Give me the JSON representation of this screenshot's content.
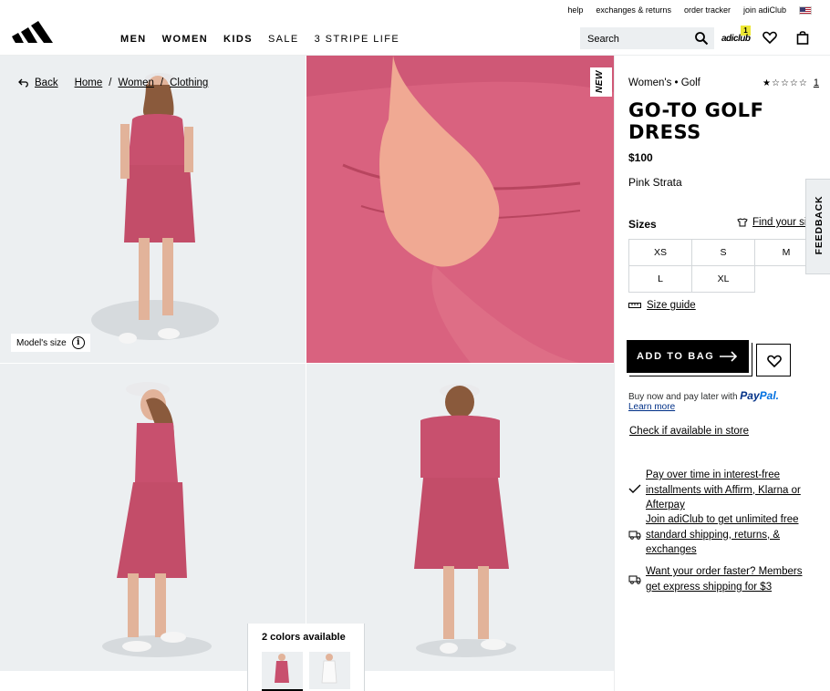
{
  "header": {
    "utility_links": [
      "help",
      "exchanges & returns",
      "order tracker",
      "join adiClub"
    ],
    "nav": [
      "MEN",
      "WOMEN",
      "KIDS",
      "SALE",
      "3 STRIPE LIFE"
    ],
    "search_placeholder": "Search",
    "adiclub_badge": "1",
    "adiclub_brand": "adiclub"
  },
  "breadcrumb": {
    "back": "Back",
    "items": [
      "Home",
      "Women",
      "Clothing"
    ],
    "separator": "/"
  },
  "gallery": {
    "model_size_label": "Model's size",
    "new_badge": "NEW",
    "colors_available": "2 colors available"
  },
  "product": {
    "category": "Women's • Golf",
    "rating_count": "1",
    "title": "GO-TO GOLF DRESS",
    "price": "$100",
    "color": "Pink Strata",
    "sizes_label": "Sizes",
    "find_your_size": "Find your size",
    "sizes": [
      "XS",
      "S",
      "M",
      "L",
      "XL"
    ],
    "size_guide": "Size guide",
    "add_to_bag": "ADD TO BAG",
    "paypal_text": "Buy now and pay later with",
    "paypal_brand_1": "Pay",
    "paypal_brand_2": "Pal.",
    "learn_more": "Learn more",
    "check_store": "Check if available in store",
    "perks": [
      "Pay over time in interest-free installments with Affirm, Klarna or Afterpay",
      "Join adiClub to get unlimited free standard shipping, returns, & exchanges",
      "Want your order faster? Members get express shipping for $3"
    ]
  },
  "feedback_tab": "FEEDBACK",
  "colors": {
    "dress_pink": "#c8506e",
    "tile_bg": "#eceff1",
    "accent_yellow": "#ede734",
    "paypal_blue": "#003087"
  }
}
